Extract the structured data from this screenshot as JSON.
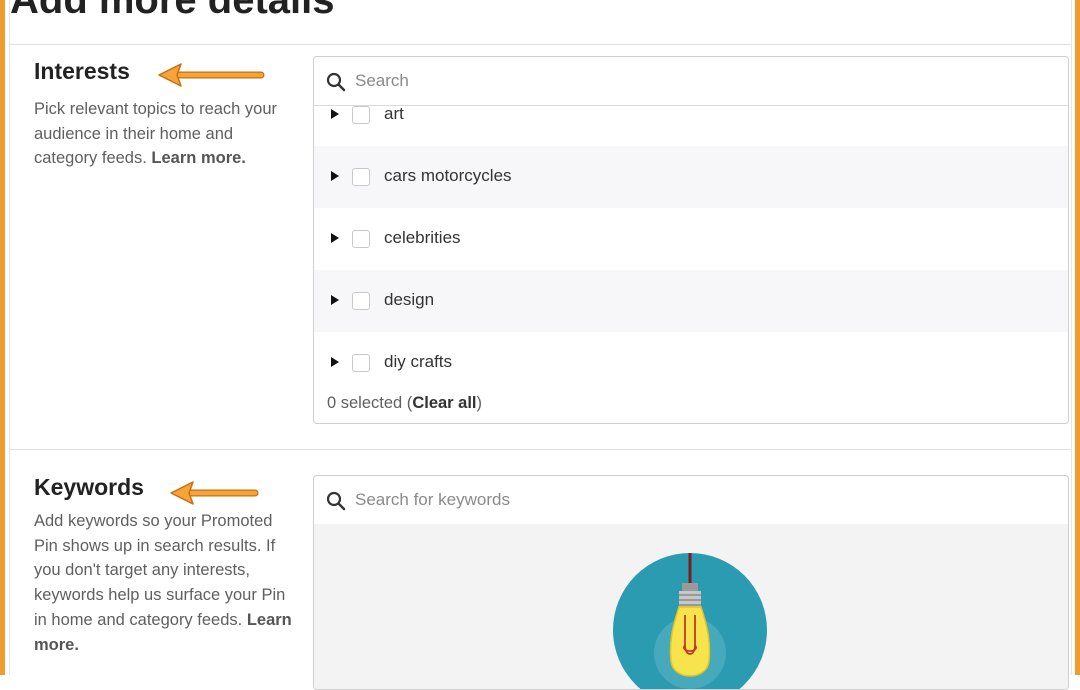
{
  "page": {
    "title": "Add more details"
  },
  "interests": {
    "title": "Interests",
    "description": "Pick relevant topics to reach your audience in their home and category feeds.",
    "learn_more": "Learn more.",
    "search_placeholder": "Search",
    "items": [
      {
        "label": "art"
      },
      {
        "label": "cars motorcycles"
      },
      {
        "label": "celebrities"
      },
      {
        "label": "design"
      },
      {
        "label": "diy crafts"
      }
    ],
    "selected_count": "0 selected",
    "clear_all": "Clear all"
  },
  "keywords": {
    "title": "Keywords",
    "description": "Add keywords so your Promoted Pin shows up in search results. If you don't target any interests, keywords help us surface your Pin in home and category feeds.",
    "learn_more": "Learn more.",
    "search_placeholder": "Search for keywords"
  },
  "colors": {
    "annotation_orange": "#f29b2e",
    "illustration_teal": "#2a9bb0",
    "bulb_yellow": "#f7e34b"
  },
  "icons": [
    "search-icon",
    "expand-triangle-icon",
    "checkbox",
    "annotation-arrow-icon",
    "light-bulb-illustration"
  ]
}
